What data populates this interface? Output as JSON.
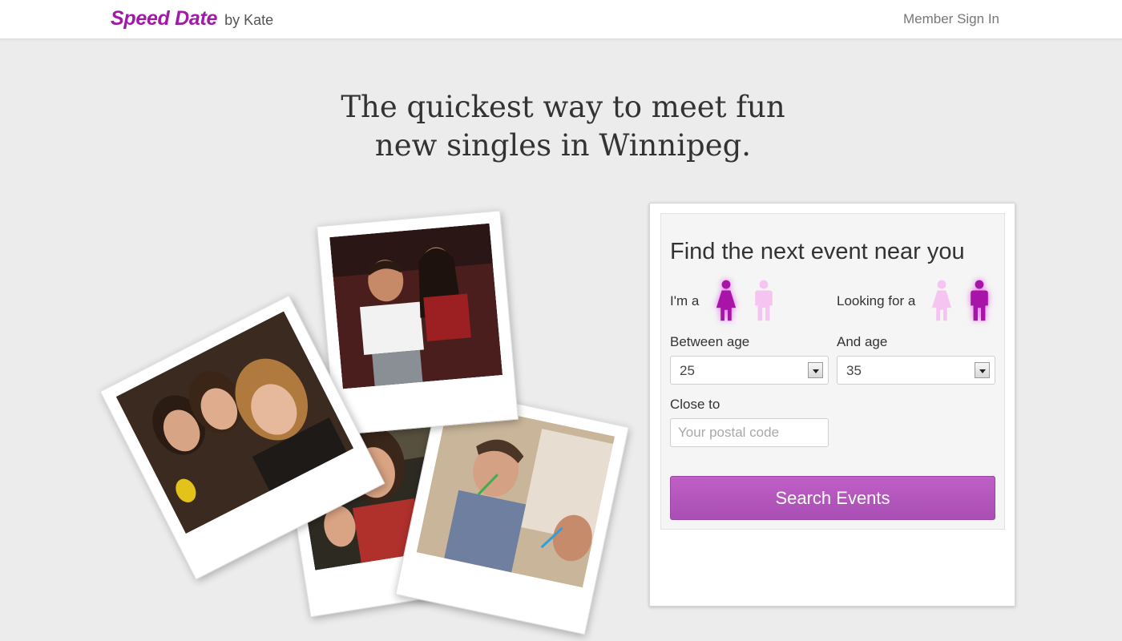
{
  "header": {
    "brand_name": "Speed Date",
    "brand_by": "by Kate",
    "signin_label": "Member Sign In"
  },
  "hero": {
    "line1": "The quickest way to meet fun",
    "line2": "new singles in Winnipeg."
  },
  "photos": [
    {
      "name": "photo-woman-smiling"
    },
    {
      "name": "photo-man-drinking"
    },
    {
      "name": "photo-couple-lounge"
    },
    {
      "name": "photo-group-of-women"
    }
  ],
  "form": {
    "title": "Find the next event near you",
    "im_a_label": "I'm a",
    "looking_for_label": "Looking for a",
    "im_a_selected": "female",
    "looking_for_selected": "male",
    "between_age_label": "Between age",
    "and_age_label": "And age",
    "min_age": "25",
    "max_age": "35",
    "close_to_label": "Close to",
    "postal_placeholder": "Your postal code",
    "postal_value": "",
    "search_label": "Search Events"
  },
  "colors": {
    "brand": "#a01aa8",
    "gender_active": "#a813a8",
    "gender_inactive": "#f6c4f1",
    "button": "#b457bd"
  },
  "icons": {
    "female": "female-icon",
    "male": "male-icon"
  }
}
